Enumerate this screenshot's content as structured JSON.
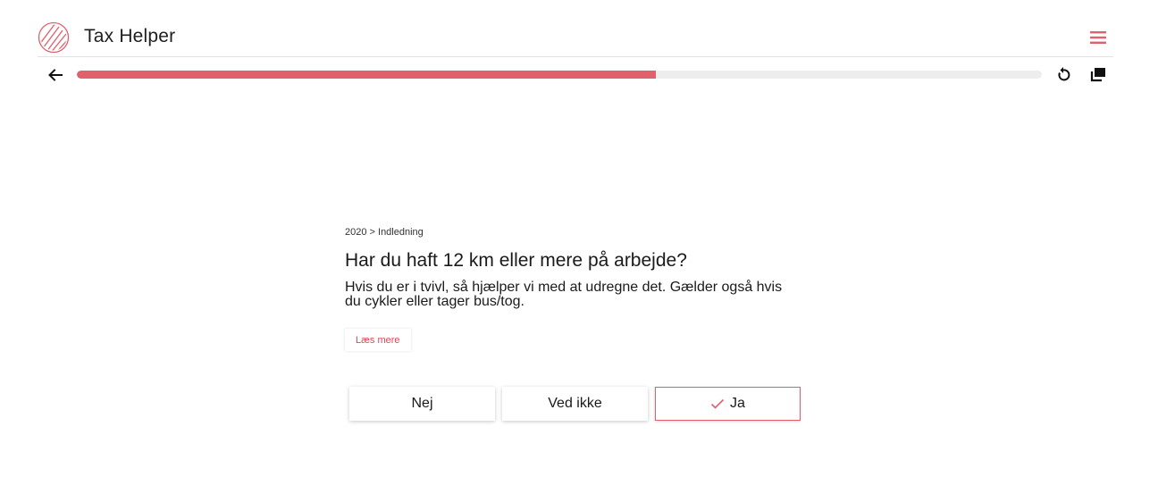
{
  "header": {
    "app_title": "Tax Helper",
    "logo_icon": "striped-circle-logo",
    "menu_icon": "hamburger-icon"
  },
  "progress": {
    "fraction": 0.6,
    "back_icon": "arrow-left-icon",
    "restart_icon": "restart-icon",
    "copy_icon": "copy-stack-icon"
  },
  "question": {
    "breadcrumb": "2020 > Indledning",
    "title": "Har du haft 12 km eller mere på arbejde?",
    "description": "Hvis du er i tvivl, så hjælper vi med at udregne det. Gælder også hvis du cykler eller tager bus/tog.",
    "read_more_label": "Læs mere"
  },
  "answers": [
    {
      "label": "Nej",
      "selected": false
    },
    {
      "label": "Ved ikke",
      "selected": false
    },
    {
      "label": "Ja",
      "selected": true
    }
  ],
  "colors": {
    "accent": "#e0606c",
    "accent_text": "#d94a57",
    "track": "#ededed"
  }
}
